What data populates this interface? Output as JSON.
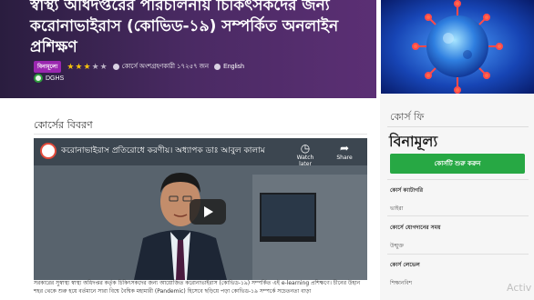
{
  "hero": {
    "title": "স্বাস্থ্য অধিদপ্তরের পরিচালনায় চিকিৎসকদের জন্য করোনাভাইরাস (কোভিড-১৯) সম্পর্কিত অনলাইন প্রশিক্ষণ",
    "badge": "বিনামূল্যে",
    "rating": 3,
    "rating_max": 5,
    "enrolled_text": "কোর্সে অংশগ্রহণকারী ১৭২৫৭ জন",
    "language": "English",
    "organization": "DGHS"
  },
  "description": {
    "section_title": "কোর্সের বিবরণ",
    "video_title": "করোনাভাইরাস প্রতিরোধে করণীয়। অধ্যাপক ডাঃ আবুল কালাম",
    "watch_later": "Watch later",
    "share": "Share",
    "caption": "সরকারের সুস্বাস্থ্য স্বাস্থ্য অধিদপ্তর কর্তৃক চিকিৎসকদের জন্য আয়োজিত করোনাভাইরাস (কোভিড-১৯) সম্পর্কিত এই e-learning প্রশিক্ষণে। চীনের উহান শহর থেকে শুরু হয়ে বর্তমানে সারা বিশ্বে বৈশ্বিক মহামারী (Pandemic) হিসেবে ছড়িয়ে পড়া কোভিড-১৯ সম্পর্কে সচেতনতা বাড়া"
  },
  "sidebar": {
    "fee_label": "কোর্স ফি",
    "fee_value": "বিনামূল্য",
    "enroll_button": "কোর্সটি শুরু করুন",
    "category_label": "কোর্স ক্যাটাগরি",
    "category_value": "ভাইরা",
    "duration_label": "কোর্সে যোগদানের সময়",
    "duration_value": "উন্মুক্ত",
    "level_label": "কোর্স লেভেল",
    "level_value": "শিক্ষানবিশ"
  },
  "overlay": {
    "activate_text": "Activ"
  },
  "colors": {
    "accent_green": "#27a844",
    "hero_purple": "#4a2a63",
    "badge_purple": "#9b27b0",
    "star_gold": "#f4c20d"
  }
}
